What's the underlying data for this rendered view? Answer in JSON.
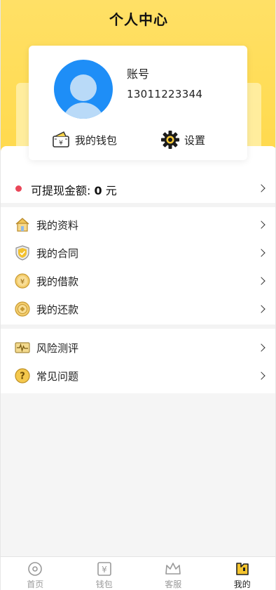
{
  "header": {
    "title": "个人中心"
  },
  "profile": {
    "account_label": "账号",
    "account_number": "13011223344",
    "wallet_label": "我的钱包",
    "settings_label": "设置"
  },
  "balance": {
    "label": "可提现金额: ",
    "amount": "0",
    "unit": "元",
    "dot_color": "#e94759"
  },
  "menu_group_1": [
    {
      "label": "我的资料",
      "icon": "house-icon"
    },
    {
      "label": "我的合同",
      "icon": "shield-check-icon"
    },
    {
      "label": "我的借款",
      "icon": "yen-coin-icon"
    },
    {
      "label": "我的还款",
      "icon": "coin-icon"
    }
  ],
  "menu_group_2": [
    {
      "label": "风险测评",
      "icon": "pulse-card-icon"
    },
    {
      "label": "常见问题",
      "icon": "question-icon"
    }
  ],
  "tabbar": [
    {
      "label": "首页",
      "icon": "home-compass-icon",
      "active": false
    },
    {
      "label": "钱包",
      "icon": "yen-wallet-icon",
      "active": false
    },
    {
      "label": "客服",
      "icon": "crown-icon",
      "active": false
    },
    {
      "label": "我的",
      "icon": "mine-icon",
      "active": true
    }
  ],
  "colors": {
    "accent": "#ffdc55",
    "avatar": "#1e8ef7"
  }
}
